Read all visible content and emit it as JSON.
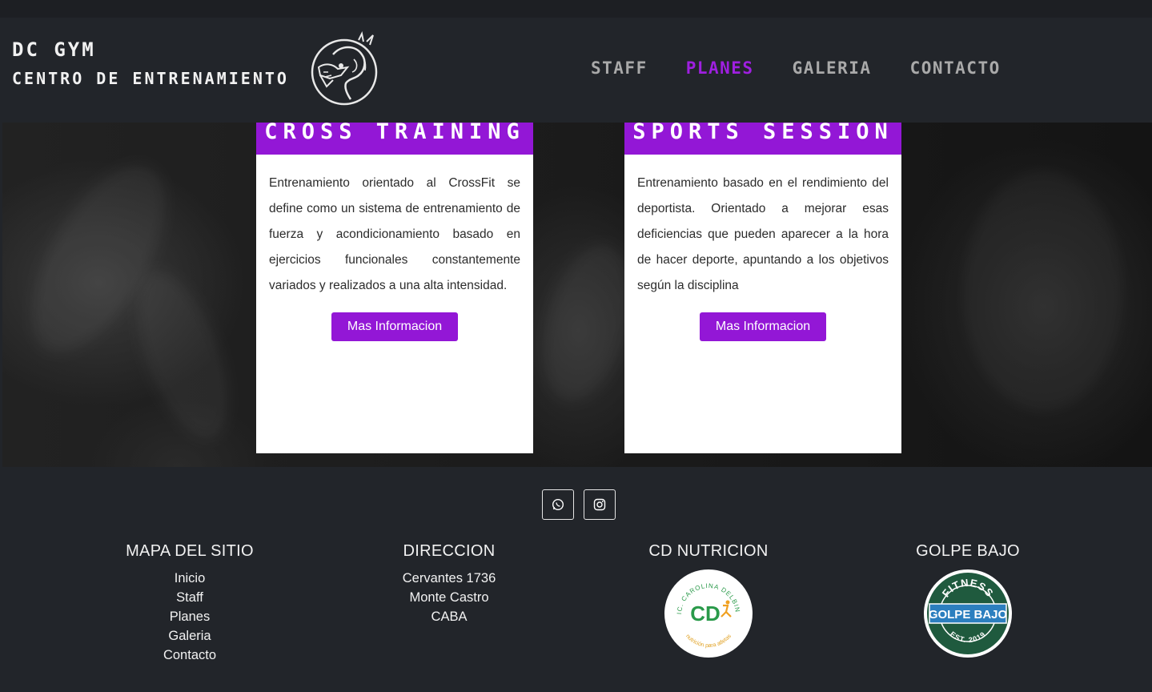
{
  "header": {
    "brand_name": "DC GYM",
    "brand_subtitle": "CENTRO DE ENTRENAMIENTO",
    "nav": [
      {
        "label": "STAFF",
        "active": false
      },
      {
        "label": "PLANES",
        "active": true
      },
      {
        "label": "GALERIA",
        "active": false
      },
      {
        "label": "CONTACTO",
        "active": false
      }
    ]
  },
  "plans": [
    {
      "title": "CROSS TRAINING",
      "description": "Entrenamiento orientado al CrossFit se define como un sistema de entrenamiento de fuerza y acondicionamiento basado en ejercicios funcionales constantemente variados y realizados a una alta intensidad.",
      "button": "Mas Informacion"
    },
    {
      "title": "SPORTS SESSION",
      "description": "Entrenamiento basado en el rendimiento del deportista. Orientado a mejorar esas deficiencias que pueden aparecer a la hora de hacer deporte, apuntando a los objetivos según la disciplina",
      "button": "Mas Informacion"
    }
  ],
  "footer": {
    "social": [
      "whatsapp-icon",
      "instagram-icon"
    ],
    "mapa": {
      "title": "MAPA DEL SITIO",
      "links": [
        "Inicio",
        "Staff",
        "Planes",
        "Galeria",
        "Contacto"
      ]
    },
    "direccion": {
      "title": "DIRECCION",
      "lines": [
        "Cervantes 1736",
        "Monte Castro",
        "CABA"
      ]
    },
    "cd_nutricion": {
      "title": "CD NUTRICION",
      "logo_top": "LIC. CAROLINA DELBINO",
      "logo_center": "CD",
      "logo_bottom": "nutrición para atletas"
    },
    "golpe_bajo": {
      "title": "GOLPE BAJO",
      "logo_top": "FITNESS",
      "logo_center": "GOLPE BAJO",
      "logo_bottom": "EST. 2019"
    }
  },
  "colors": {
    "accent": "#9317d6",
    "nav_active": "#9f1fe0",
    "background": "#22252a",
    "nav_text": "#a9a9a9"
  }
}
